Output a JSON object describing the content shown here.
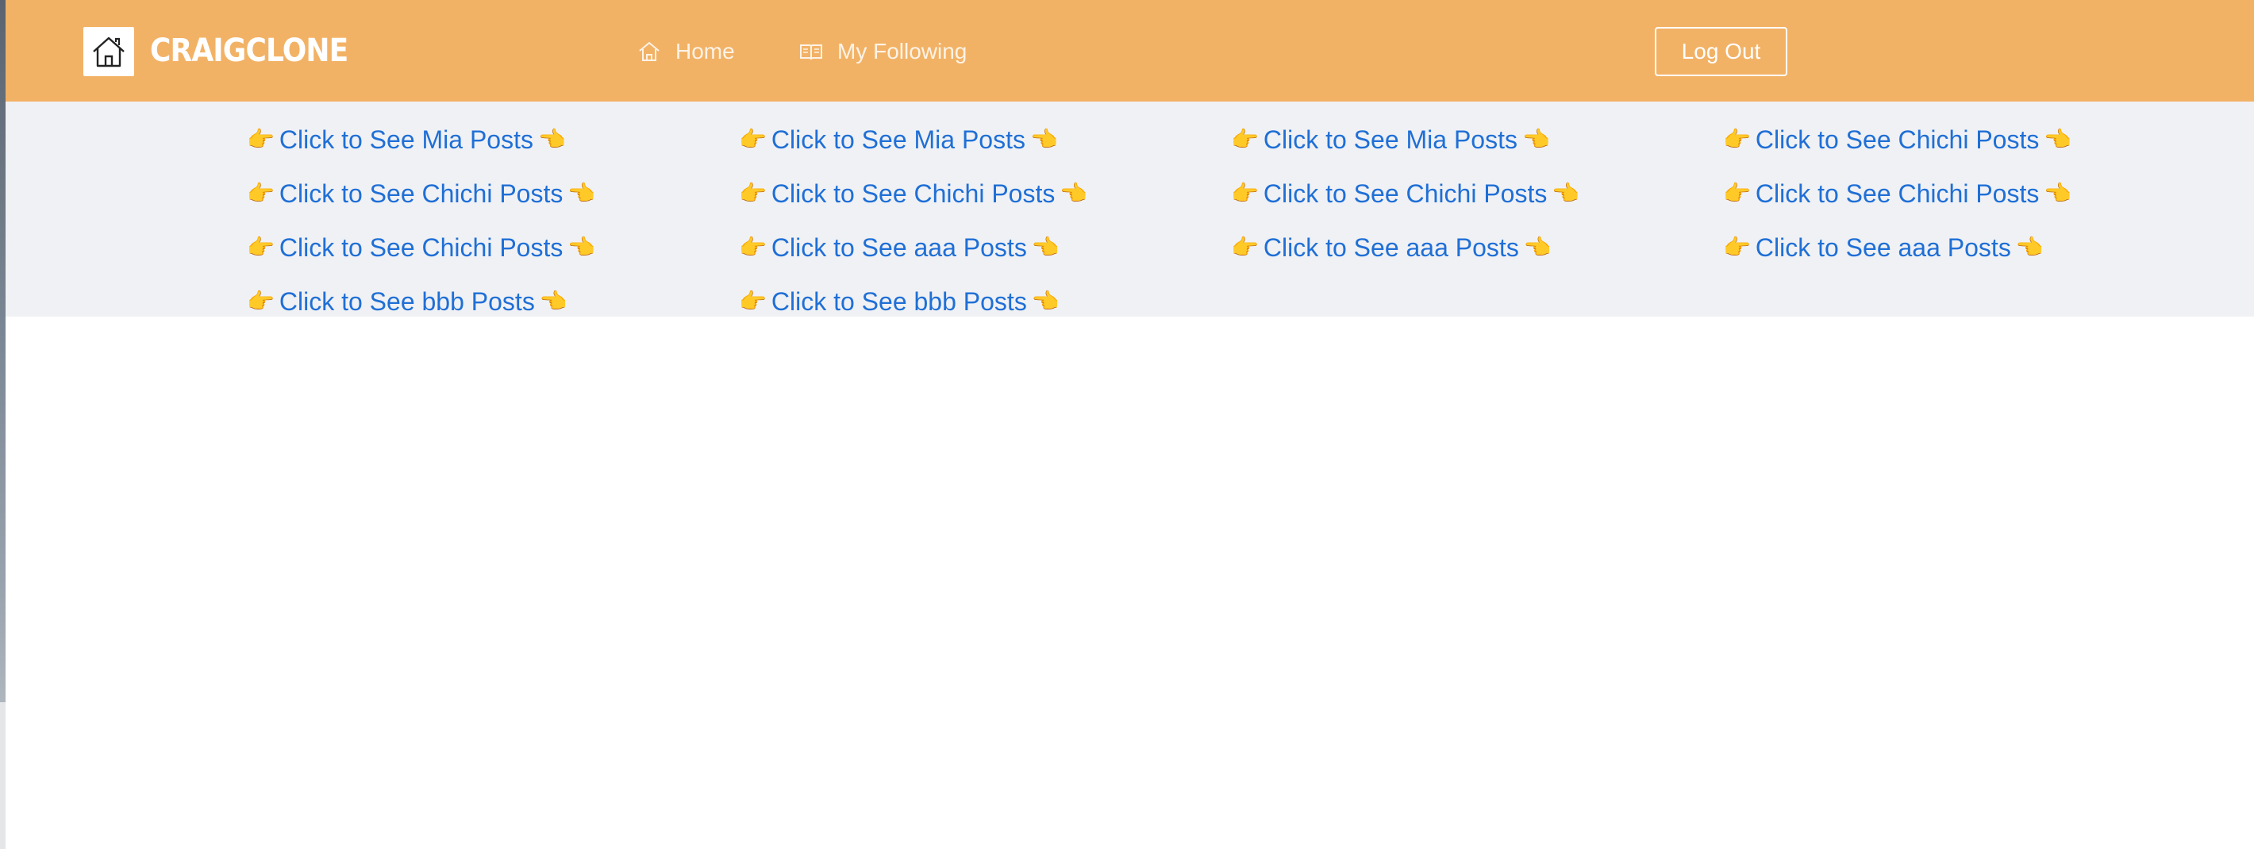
{
  "header": {
    "brand": "CRAIGCLONE",
    "nav": [
      {
        "label": "Home",
        "icon": "home-outline-icon"
      },
      {
        "label": "My Following",
        "icon": "book-open-icon"
      }
    ],
    "logout_label": "Log Out",
    "accent_color": "#f2b266"
  },
  "posts": {
    "pointer_right": "👉",
    "pointer_left": "👈",
    "link_color": "#1f6fd6",
    "links": [
      "Click to See Mia Posts",
      "Click to See Mia Posts",
      "Click to See Mia Posts",
      "Click to See Chichi Posts",
      "Click to See Chichi Posts",
      "Click to See Chichi Posts",
      "Click to See Chichi Posts",
      "Click to See Chichi Posts",
      "Click to See Chichi Posts",
      "Click to See aaa Posts",
      "Click to See aaa Posts",
      "Click to See aaa Posts",
      "Click to See bbb Posts",
      "Click to See bbb Posts"
    ]
  }
}
